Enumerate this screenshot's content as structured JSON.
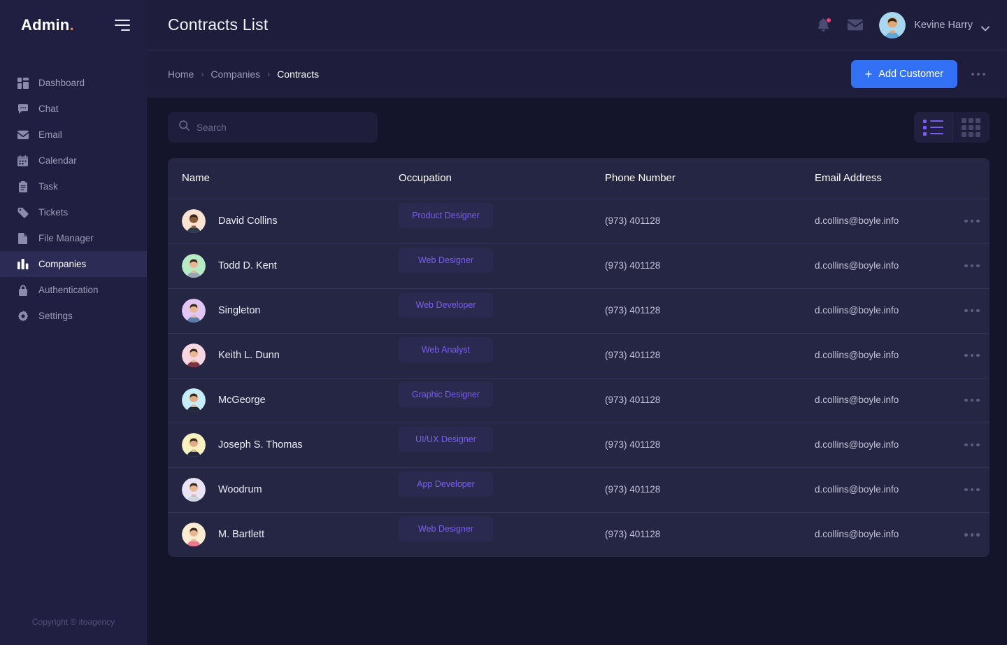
{
  "sidebar": {
    "brand": "Admin",
    "brand_dot": ".",
    "menu_icon": "hamburger-icon",
    "items": [
      {
        "label": "Dashboard",
        "icon": "dashboard-icon",
        "active": false
      },
      {
        "label": "Chat",
        "icon": "chat-icon",
        "active": false
      },
      {
        "label": "Email",
        "icon": "email-icon",
        "active": false
      },
      {
        "label": "Calendar",
        "icon": "calendar-icon",
        "active": false
      },
      {
        "label": "Task",
        "icon": "task-icon",
        "active": false
      },
      {
        "label": "Tickets",
        "icon": "ticket-icon",
        "active": false
      },
      {
        "label": "File Manager",
        "icon": "file-icon",
        "active": false
      },
      {
        "label": "Companies",
        "icon": "chart-bar-icon",
        "active": true
      },
      {
        "label": "Authentication",
        "icon": "lock-icon",
        "active": false
      },
      {
        "label": "Settings",
        "icon": "gear-icon",
        "active": false
      }
    ],
    "copyright": "Copyright © itoagency"
  },
  "topbar": {
    "title": "Contracts List",
    "notification_icon": "bell-icon",
    "notification_has_badge": true,
    "mail_icon": "envelope-icon",
    "user_name": "Kevine Harry",
    "caret_icon": "chevron-down-icon"
  },
  "breadcrumb": {
    "items": [
      {
        "label": "Home",
        "current": false
      },
      {
        "label": "Companies",
        "current": false
      },
      {
        "label": "Contracts",
        "current": true
      }
    ],
    "separator": "›",
    "add_button_label": "Add Customer",
    "add_button_icon": "plus-icon",
    "overflow_icon": "more-horizontal-icon"
  },
  "toolbar": {
    "search_placeholder": "Search",
    "search_value": "",
    "search_icon": "search-icon",
    "list_view_icon": "list-view-icon",
    "grid_view_icon": "grid-view-icon",
    "active_view": "list"
  },
  "colors": {
    "accent_blue": "#3270f5",
    "accent_purple": "#7b5cf5",
    "sidebar_bg": "#201f41",
    "sidebar_active_bg": "#2c2b55",
    "page_bg": "#14142b",
    "panel_bg": "#1e1e3c",
    "card_bg": "#252544",
    "chip_bg": "#2a2a50",
    "badge_red": "#f1416c",
    "brand_dot": "#f0803c"
  },
  "table": {
    "columns": [
      "Name",
      "Occupation",
      "Phone Number",
      "Email Address"
    ],
    "rows": [
      {
        "name": "David Collins",
        "occupation": "Product Designer",
        "phone": "(973) 401128",
        "email": "d.collins@boyle.info",
        "avatar_bg": "#fbe3d4",
        "shirt": "#2f3b4d",
        "skin": "#8a5a3b"
      },
      {
        "name": "Todd D. Kent",
        "occupation": "Web Designer",
        "phone": "(973) 401128",
        "email": "d.collins@boyle.info",
        "avatar_bg": "#b7ebc6",
        "shirt": "#9aa6b4",
        "skin": "#e8b894"
      },
      {
        "name": "Singleton",
        "occupation": "Web Developer",
        "phone": "(973) 401128",
        "email": "d.collins@boyle.info",
        "avatar_bg": "#e2c6f5",
        "shirt": "#5b7fa6",
        "skin": "#e8b894"
      },
      {
        "name": "Keith L. Dunn",
        "occupation": "Web Analyst",
        "phone": "(973) 401128",
        "email": "d.collins@boyle.info",
        "avatar_bg": "#f9d7e2",
        "shirt": "#7d3240",
        "skin": "#e8b894"
      },
      {
        "name": "McGeorge",
        "occupation": "Graphic Designer",
        "phone": "(973) 401128",
        "email": "d.collins@boyle.info",
        "avatar_bg": "#c7eef8",
        "shirt": "#22283a",
        "skin": "#e0ad86"
      },
      {
        "name": "Joseph S. Thomas",
        "occupation": "UI/UX Designer",
        "phone": "(973) 401128",
        "email": "d.collins@boyle.info",
        "avatar_bg": "#f8f2c0",
        "shirt": "#23283b",
        "skin": "#e0ad86"
      },
      {
        "name": "Woodrum",
        "occupation": "App Developer",
        "phone": "(973) 401128",
        "email": "d.collins@boyle.info",
        "avatar_bg": "#e8e3f7",
        "shirt": "#cfd6dd",
        "skin": "#e8b894"
      },
      {
        "name": "M. Bartlett",
        "occupation": "Web Designer",
        "phone": "(973) 401128",
        "email": "d.collins@boyle.info",
        "avatar_bg": "#fbedd2",
        "shirt": "#e8798f",
        "skin": "#e8b894"
      }
    ],
    "row_action_icon": "more-horizontal-icon"
  }
}
